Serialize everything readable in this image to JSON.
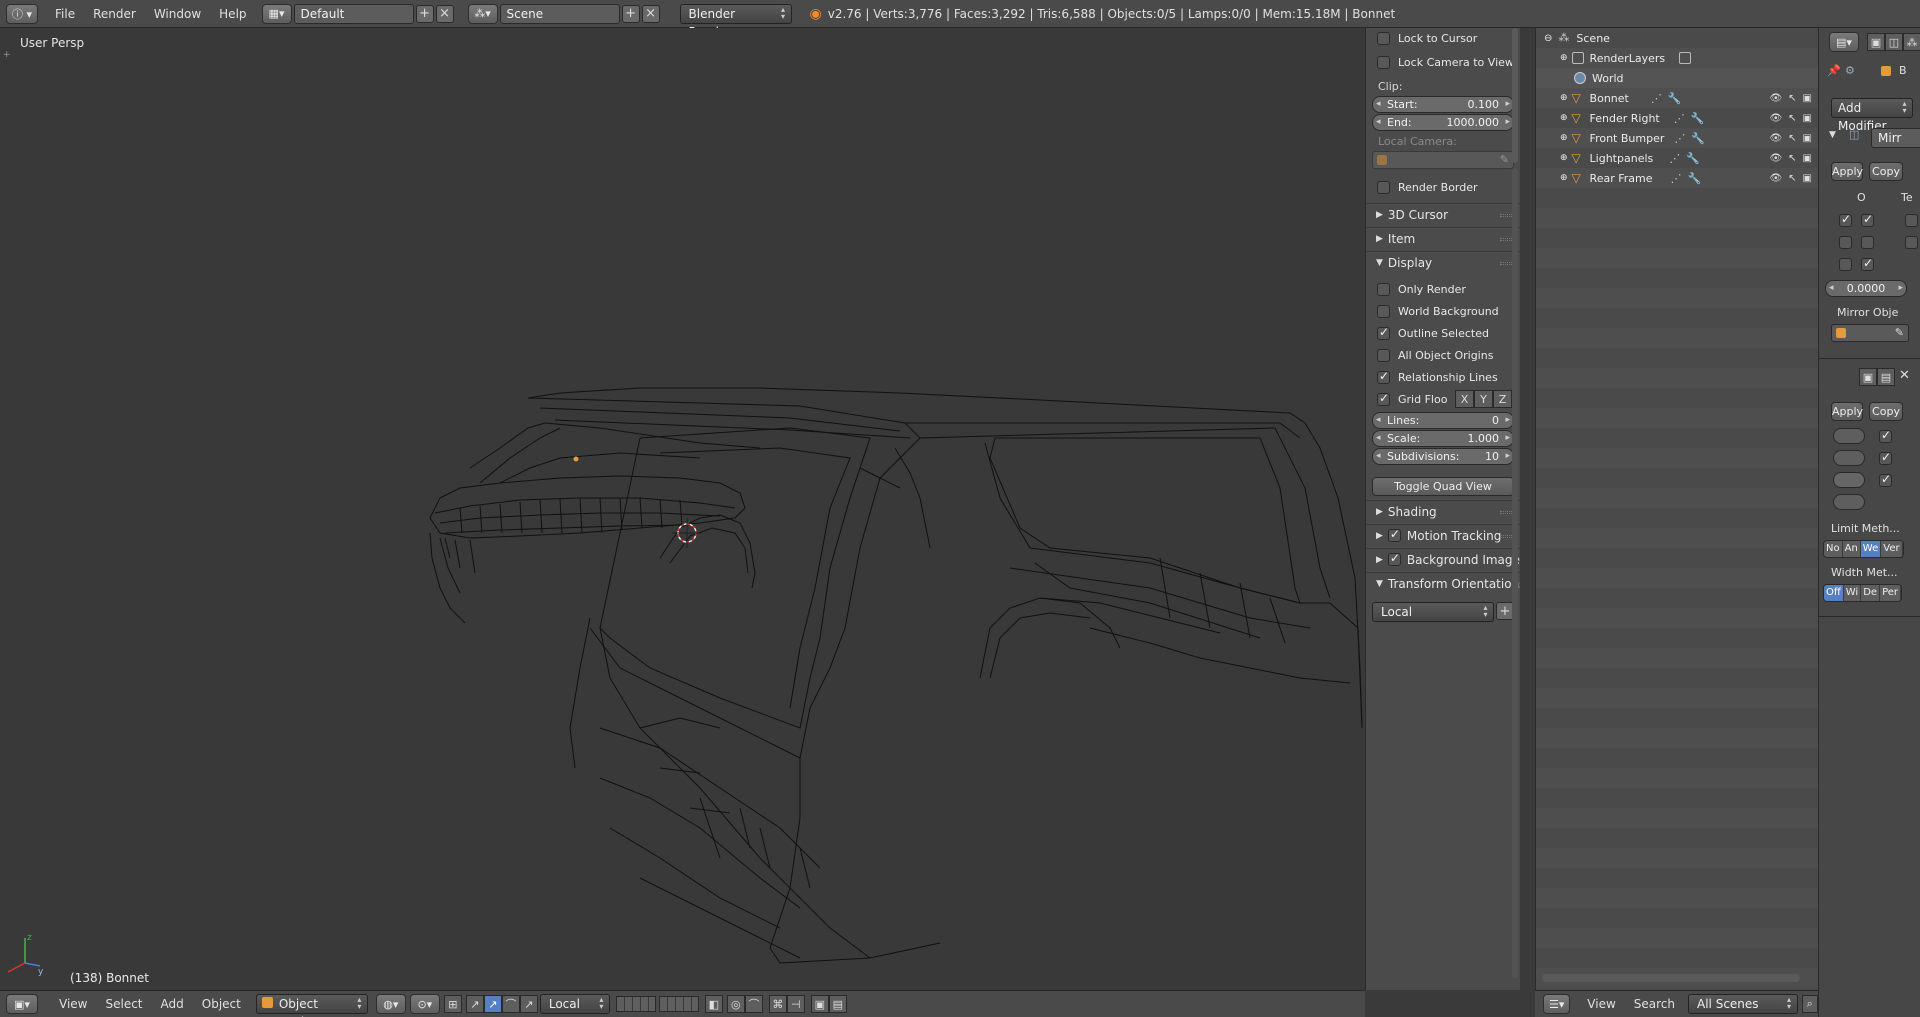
{
  "topbar": {
    "menus": [
      "File",
      "Render",
      "Window",
      "Help"
    ],
    "screen_layout": "Default",
    "scene": "Scene",
    "render_engine": "Blender Render",
    "stats": "v2.76 | Verts:3,776 | Faces:3,292 | Tris:6,588 | Objects:0/5 | Lamps:0/0 | Mem:15.18M | Bonnet"
  },
  "viewport": {
    "view_label": "User Persp",
    "object_label": "(138) Bonnet"
  },
  "viewport_header": {
    "menus": [
      "View",
      "Select",
      "Add",
      "Object"
    ],
    "mode": "Object Mode",
    "orientation": "Local"
  },
  "npanel": {
    "lock_to_cursor": "Lock to Cursor",
    "lock_camera": "Lock Camera to View",
    "clip_label": "Clip:",
    "clip_start_label": "Start:",
    "clip_start_value": "0.100",
    "clip_end_label": "End:",
    "clip_end_value": "1000.000",
    "local_camera_label": "Local Camera:",
    "render_border": "Render Border",
    "sections": {
      "cursor": "3D Cursor",
      "item": "Item",
      "display": "Display",
      "shading": "Shading",
      "motion_tracking": "Motion Tracking",
      "background_images": "Background Images",
      "transform_orientations": "Transform Orientations"
    },
    "display": {
      "only_render": "Only Render",
      "world_background": "World Background",
      "outline_selected": "Outline Selected",
      "all_object_origins": "All Object Origins",
      "relationship_lines": "Relationship Lines",
      "grid_floor": "Grid Floo",
      "axis_x": "X",
      "axis_y": "Y",
      "axis_z": "Z",
      "lines_label": "Lines:",
      "lines_value": "0",
      "scale_label": "Scale:",
      "scale_value": "1.000",
      "subdivisions_label": "Subdivisions:",
      "subdivisions_value": "10"
    },
    "toggle_quad_view": "Toggle Quad View",
    "orientation_value": "Local"
  },
  "outliner": {
    "rows": [
      {
        "label": "Scene",
        "type": "scene"
      },
      {
        "label": "RenderLayers",
        "type": "renderlayers"
      },
      {
        "label": "World",
        "type": "world"
      },
      {
        "label": "Bonnet",
        "type": "mesh"
      },
      {
        "label": "Fender Right",
        "type": "mesh"
      },
      {
        "label": "Front Bumper",
        "type": "mesh"
      },
      {
        "label": "Lightpanels",
        "type": "mesh"
      },
      {
        "label": "Rear Frame",
        "type": "mesh"
      }
    ],
    "footer_menus": [
      "View",
      "Search"
    ],
    "scene_filter": "All Scenes"
  },
  "modifiers": {
    "object_short": "B",
    "add_modifier": "Add Modifier",
    "mirror_short": "Mirr",
    "apply": "Apply",
    "copy": "Copy",
    "col_o": "O",
    "col_te": "Te",
    "merge_value": "0.0000",
    "mirror_object_label": "Mirror Obje",
    "limit_method": "Limit Meth...",
    "limit_options": [
      "No",
      "An",
      "We",
      "Ver"
    ],
    "width_method": "Width Met...",
    "width_options": [
      "Off",
      "Wi",
      "De",
      "Per"
    ]
  },
  "colors": {
    "accent": "#5680c2",
    "mesh_icon": "#e79a3c",
    "cursor_red": "#d33",
    "wire": "#111111"
  }
}
